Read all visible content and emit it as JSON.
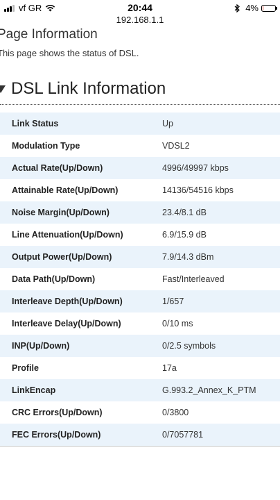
{
  "status_bar": {
    "carrier": "vf GR",
    "time": "20:44",
    "battery_percent": "4%",
    "battery_level": 0.04
  },
  "browser": {
    "url": "192.168.1.1"
  },
  "page": {
    "title": "Page Information",
    "description": "This page shows the status of DSL."
  },
  "section": {
    "title": "DSL Link Information"
  },
  "rows": [
    {
      "label": "Link Status",
      "value": "Up"
    },
    {
      "label": "Modulation Type",
      "value": "VDSL2"
    },
    {
      "label": "Actual Rate(Up/Down)",
      "value": "4996/49997 kbps"
    },
    {
      "label": "Attainable Rate(Up/Down)",
      "value": "14136/54516 kbps"
    },
    {
      "label": "Noise Margin(Up/Down)",
      "value": "23.4/8.1 dB"
    },
    {
      "label": "Line Attenuation(Up/Down)",
      "value": "6.9/15.9 dB"
    },
    {
      "label": "Output Power(Up/Down)",
      "value": "7.9/14.3 dBm"
    },
    {
      "label": "Data Path(Up/Down)",
      "value": "Fast/Interleaved"
    },
    {
      "label": "Interleave Depth(Up/Down)",
      "value": "1/657"
    },
    {
      "label": "Interleave Delay(Up/Down)",
      "value": "0/10 ms"
    },
    {
      "label": "INP(Up/Down)",
      "value": "0/2.5 symbols"
    },
    {
      "label": "Profile",
      "value": "17a"
    },
    {
      "label": "LinkEncap",
      "value": "G.993.2_Annex_K_PTM"
    },
    {
      "label": "CRC Errors(Up/Down)",
      "value": "0/3800"
    },
    {
      "label": "FEC Errors(Up/Down)",
      "value": "0/7057781"
    }
  ]
}
